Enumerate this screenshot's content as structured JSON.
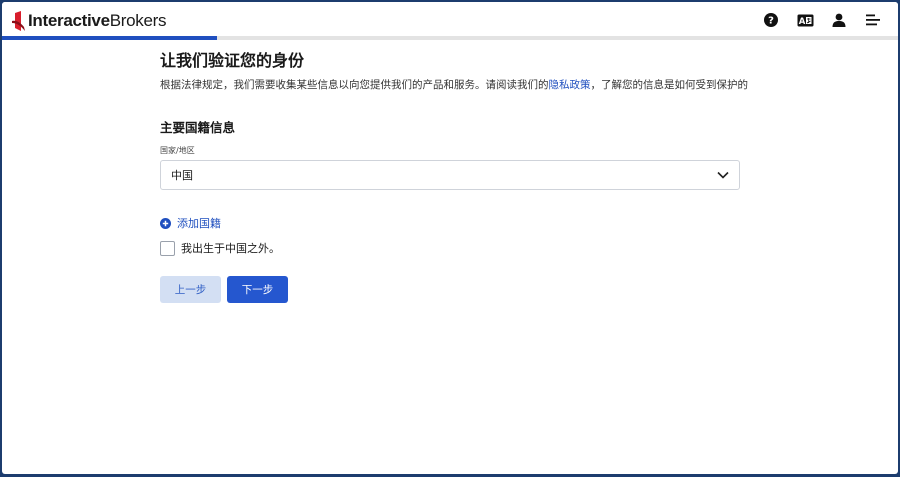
{
  "header": {
    "logo_bold": "Interactive",
    "logo_light": "Brokers",
    "icons": [
      "help-icon",
      "language-icon",
      "user-icon",
      "menu-icon"
    ],
    "progress_fraction": 0.24
  },
  "main": {
    "title": "让我们验证您的身份",
    "intro_before": "根据法律规定，我们需要收集某些信息以向您提供我们的产品和服务。请阅读我们的",
    "intro_link": "隐私政策",
    "intro_after": "，了解您的信息是如何受到保护的",
    "section_title": "主要国籍信息",
    "country_label": "国家/地区",
    "country_value": "中国",
    "add_nationality": "添加国籍",
    "born_outside_label": "我出生于中国之外。",
    "born_outside_checked": false,
    "prev_button": "上一步",
    "next_button": "下一步"
  },
  "colors": {
    "accent": "#2557cf",
    "prev_button_bg": "#d3dff3",
    "logo_red": "#d81e2c",
    "frame_border": "#1c3c6e"
  }
}
